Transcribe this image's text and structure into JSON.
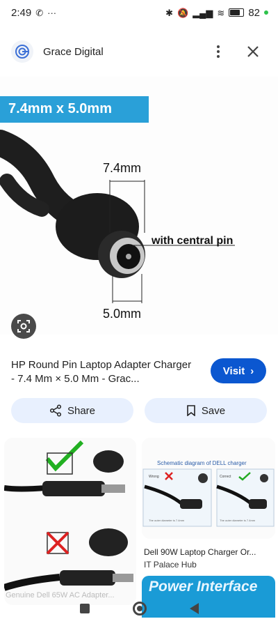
{
  "status": {
    "time": "2:49",
    "battery": "82"
  },
  "header": {
    "site_name": "Grace Digital"
  },
  "image": {
    "banner": "7.4mm x 5.0mm",
    "label_outer": "7.4mm",
    "label_pin": "with central pin",
    "label_inner": "5.0mm"
  },
  "result": {
    "title": "HP Round Pin Laptop Adapter Charger - 7.4 Mm × 5.0 Mm - Grac...",
    "visit_label": "Visit"
  },
  "actions": {
    "share_label": "Share",
    "save_label": "Save"
  },
  "related": [
    {
      "caption": "Genuine Dell 65W AC Adapter..."
    },
    {
      "image_title": "Schematic diagram of DELL charger",
      "wrong": "Wrong",
      "correct": "Correct",
      "note": "The outer diameter is 7.4mm",
      "title": "Dell 90W Laptop Charger Or...",
      "source": "IT Palace Hub"
    },
    {
      "banner": "Power Interface"
    }
  ],
  "colors": {
    "accent": "#0b57d0",
    "banner": "#2aa0d8",
    "chip": "#e8f0fe"
  }
}
